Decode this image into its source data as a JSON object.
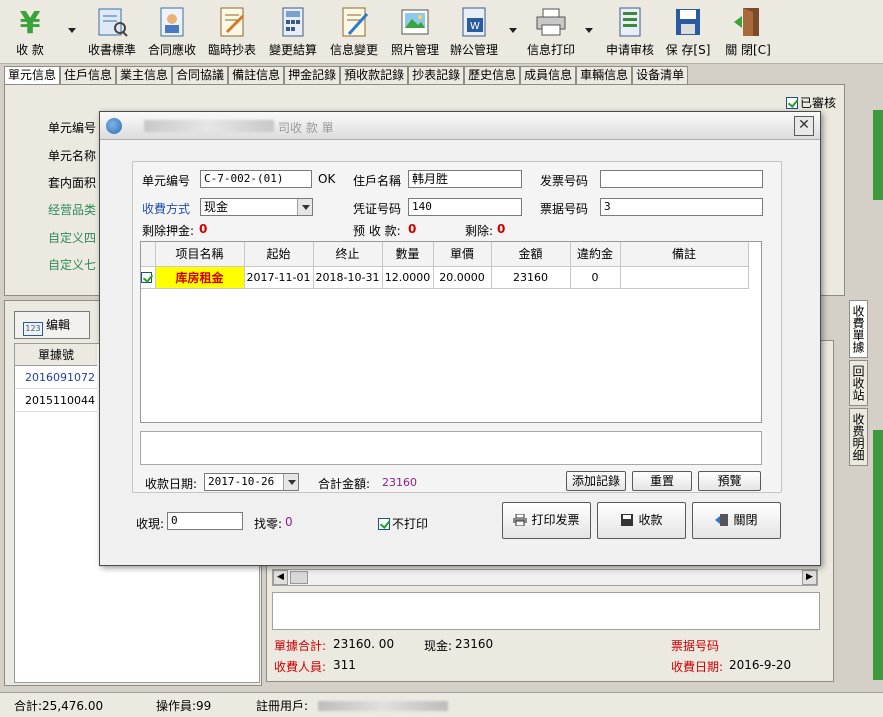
{
  "toolbar": {
    "items": [
      {
        "label": "收 款",
        "icon": "yen-icon"
      },
      {
        "label": "收書標準",
        "icon": "standard-icon"
      },
      {
        "label": "合同應收",
        "icon": "contract-receivable-icon"
      },
      {
        "label": "臨時抄表",
        "icon": "meter-reading-icon"
      },
      {
        "label": "變更結算",
        "icon": "settlement-icon"
      },
      {
        "label": "信息變更",
        "icon": "edit-doc-icon"
      },
      {
        "label": "照片管理",
        "icon": "photo-icon"
      },
      {
        "label": "辦公管理",
        "icon": "office-icon"
      },
      {
        "label": "信息打印",
        "icon": "printer-icon"
      },
      {
        "label": "申请审核",
        "icon": "audit-icon"
      },
      {
        "label": "保 存[S]",
        "icon": "save-icon"
      },
      {
        "label": "關 閉[C]",
        "icon": "exit-icon"
      }
    ]
  },
  "tabs": [
    "單元信息",
    "住戶信息",
    "業主信息",
    "合同協議",
    "備註信息",
    "押金記錄",
    "預收款記錄",
    "抄表記錄",
    "歷史信息",
    "成員信息",
    "車輛信息",
    "设备清单"
  ],
  "approved_label": "已審核",
  "bg_labels": {
    "unit_no": "单元编号",
    "unit_name": "单元名称",
    "area": "套内面积",
    "category": "经营品类",
    "custom4": "自定义四",
    "custom7": "自定义七"
  },
  "left": {
    "edit_button": "编輯",
    "edit_icon_text": "123",
    "col_header": "單據號",
    "rows": [
      "2016091072",
      "2015110044"
    ]
  },
  "right": {
    "summary_total_label": "單據合計:",
    "summary_total_value": "23160. 00",
    "cash_label": "现金:",
    "cash_value": "23160",
    "collector_label": "收費人員:",
    "collector_value": "311",
    "receipt_no_label": "票据号码",
    "charge_date_label": "收費日期:",
    "charge_date_value": "2016-9-20"
  },
  "vtabs": [
    "收費單據",
    "回收站",
    "收费明细"
  ],
  "status": {
    "total": "合計:25,476.00",
    "operator": "操作員:99",
    "registered": "註冊用戶:"
  },
  "dialog": {
    "title_suffix": "司收 款 單",
    "close": "✕",
    "unit_no_label": "单元编号",
    "unit_no_value": "C-7-002-(01)",
    "ok_text": "OK",
    "resident_label": "住戶名稱",
    "resident_value": "韩月胜",
    "invoice_label": "发票号码",
    "invoice_value": "",
    "pay_method_label": "收費方式",
    "pay_method_value": "现金",
    "voucher_label": "凭证号码",
    "voucher_value": "140",
    "receipt_label": "票据号码",
    "receipt_value": "3",
    "deposit_left_label": "剩除押金:",
    "deposit_left_value": "0",
    "prepaid_label": "预 收 款:",
    "prepaid_value": "0",
    "remain_label": "剩除:",
    "remain_value": "0",
    "grid_headers": [
      "项目名稱",
      "起始",
      "终止",
      "數量",
      "單價",
      "金額",
      "違約金",
      "備註"
    ],
    "grid_rows": [
      {
        "checked": true,
        "item": "库房租金",
        "start": "2017-11-01",
        "end": "2018-10-31",
        "qty": "12.0000",
        "price": "20.0000",
        "amount": "23160",
        "penalty": "0",
        "note": ""
      }
    ],
    "date_label": "收款日期:",
    "date_value": "2017-10-26",
    "total_label": "合計金額:",
    "total_value": "23160",
    "add_button": "添加記錄",
    "reset_button": "重置",
    "preview_button": "預覽",
    "cash_in_label": "收現:",
    "cash_in_value": "0",
    "change_label": "找零:",
    "change_value": "0",
    "no_print_label": "不打印",
    "print_button": "打印发票",
    "collect_button": "收款",
    "close_button": "關閉"
  },
  "colors": {
    "accent_red": "#d00000",
    "accent_blue": "#1f4fa8",
    "highlight_yellow": "#ffff00",
    "purple_value": "#8b1f8b"
  }
}
